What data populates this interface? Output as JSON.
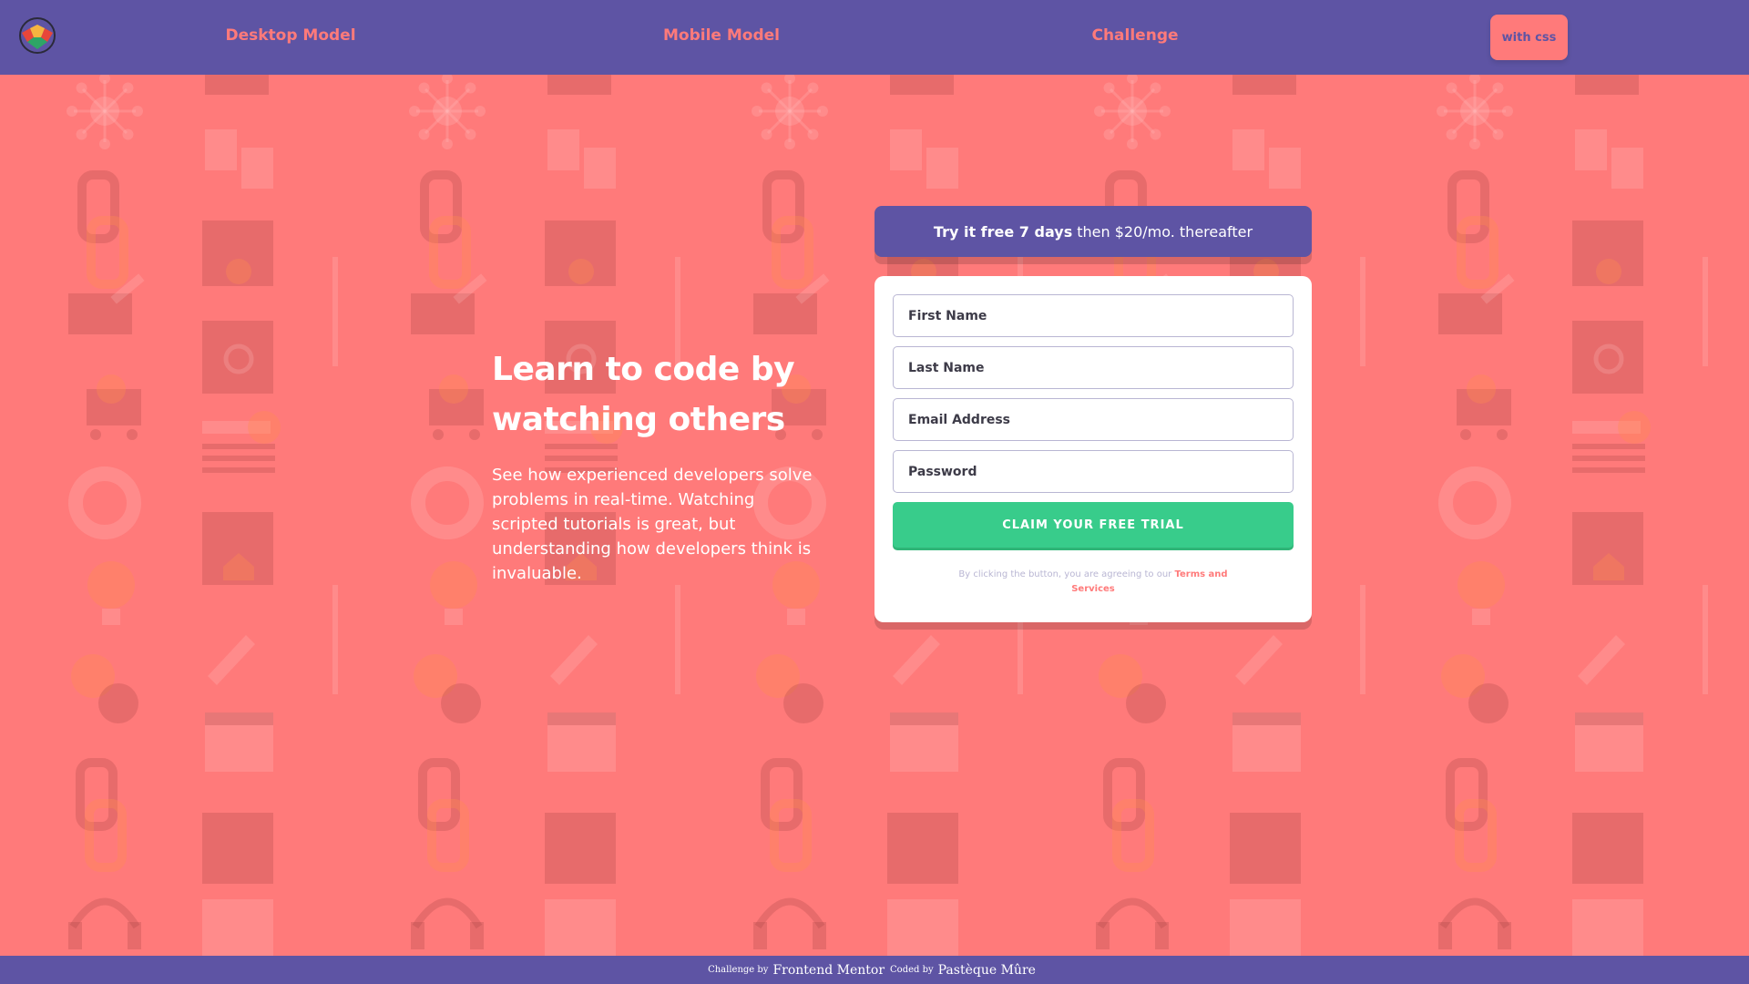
{
  "header": {
    "logo_icon": "gem-logo-icon",
    "nav": [
      {
        "label": "Desktop Model"
      },
      {
        "label": "Mobile Model"
      },
      {
        "label": "Challenge"
      }
    ],
    "css_button_label": "with css"
  },
  "hero": {
    "title": "Learn to code by watching others",
    "description": "See how experienced developers solve problems in real-time. Watching scripted tutorials is great, but understanding how developers think is invaluable."
  },
  "promo": {
    "strong": "Try it free 7 days",
    "rest": "then $20/mo. thereafter"
  },
  "form": {
    "first_name_placeholder": "First Name",
    "last_name_placeholder": "Last Name",
    "email_placeholder": "Email Address",
    "password_placeholder": "Password",
    "submit_label": "CLAIM YOUR FREE TRIAL",
    "terms_prefix": "By clicking the button, you are agreeing to our",
    "terms_link": "Terms and Services"
  },
  "footer": {
    "challenge_by": "Challenge by",
    "challenge_name": "Frontend Mentor",
    "coded_by": "Coded by",
    "coder_name": "Pastèque Mûre"
  },
  "colors": {
    "background": "#ff7a7a",
    "primary": "#5e54a4",
    "accent_green": "#38cc8b",
    "input_border": "#b9b6d3",
    "text_dark": "#3d3b48"
  }
}
